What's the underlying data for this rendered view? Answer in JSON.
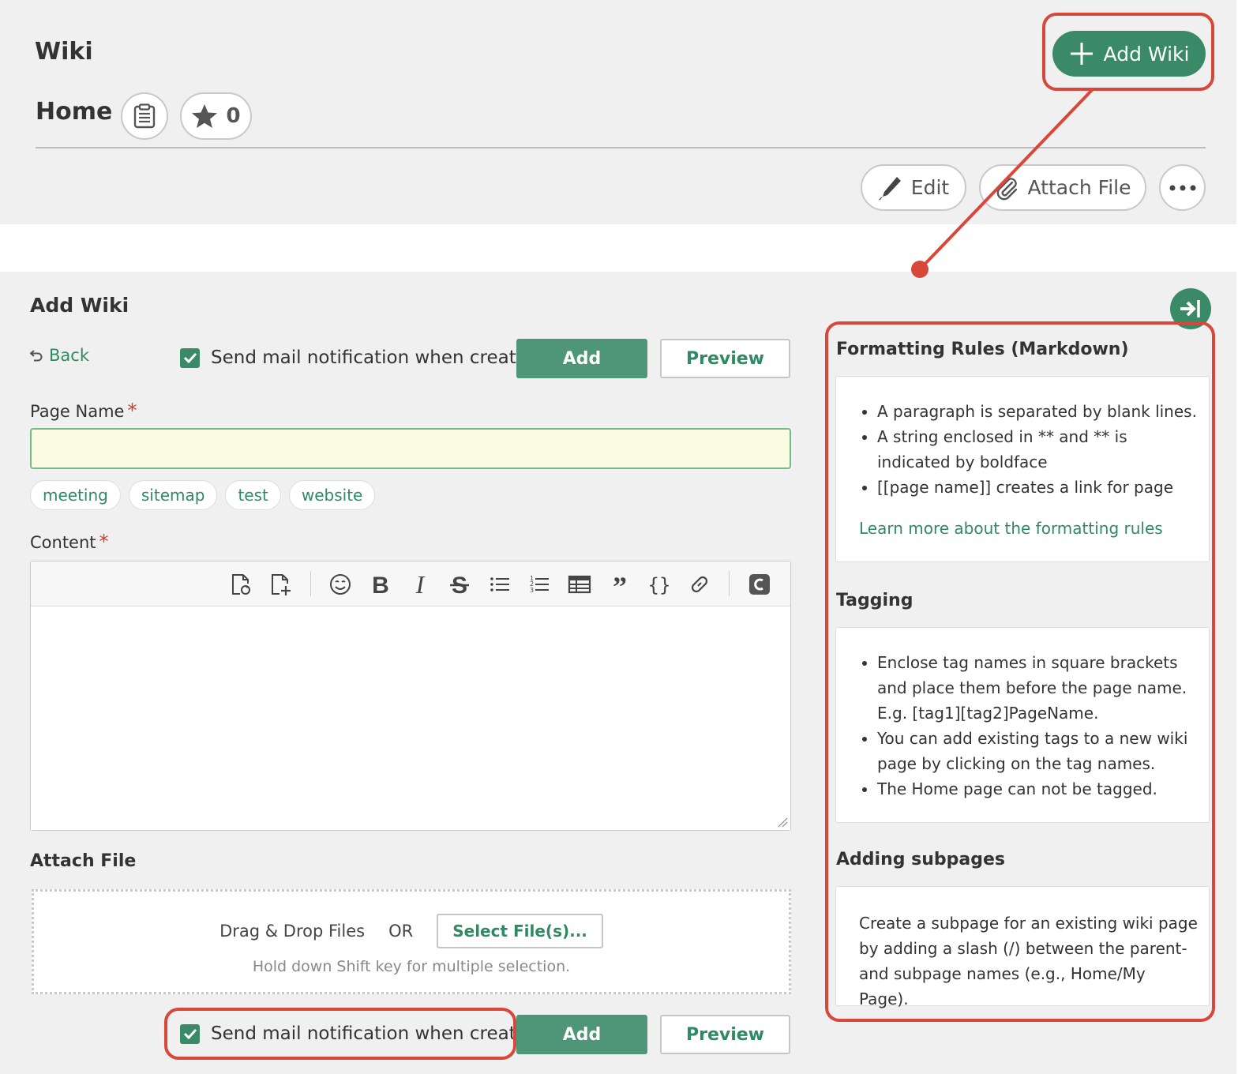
{
  "header": {
    "wiki_title": "Wiki",
    "home_title": "Home",
    "star_count": "0",
    "add_wiki_label": "Add Wiki",
    "edit_label": "Edit",
    "attach_file_label": "Attach File",
    "more_icon": "ellipsis-icon"
  },
  "form": {
    "heading": "Add Wiki",
    "back_label": "Back",
    "notify_label": "Send mail notification when created",
    "notify_checked": true,
    "add_label": "Add",
    "preview_label": "Preview",
    "page_name_label": "Page Name",
    "required_mark": "*",
    "page_name_value": "",
    "tags": [
      "meeting",
      "sitemap",
      "test",
      "website"
    ],
    "content_label": "Content",
    "content_value": "",
    "toolbar_icons": [
      "wiki-link-icon",
      "add-page-icon",
      "emoji-icon",
      "bold-icon",
      "italic-icon",
      "strikethrough-icon",
      "bullet-list-icon",
      "numbered-list-icon",
      "table-icon",
      "quote-icon",
      "code-icon",
      "link-icon",
      "color-icon"
    ],
    "attach_heading": "Attach File",
    "drag_drop_label": "Drag & Drop Files",
    "or_label": "OR",
    "select_files_label": "Select File(s)...",
    "drop_hint": "Hold down Shift key for multiple selection."
  },
  "help": {
    "formatting_heading": "Formatting Rules (Markdown)",
    "formatting_items": [
      "A paragraph is separated by blank lines.",
      "A string enclosed in ** and ** is indicated by boldface",
      "[[page name]] creates a link for page"
    ],
    "formatting_link": "Learn more about the formatting rules",
    "tagging_heading": "Tagging",
    "tagging_items": [
      "Enclose tag names in square brackets and place them before the page name. E.g. [tag1][tag2]PageName.",
      "You can add existing tags to a new wiki page by clicking on the tag names.",
      "The Home page can not be tagged."
    ],
    "subpages_heading": "Adding subpages",
    "subpages_text": "Create a subpage for an existing wiki page by adding a slash (/) between the parent- and subpage names (e.g., Home/My Page)."
  },
  "colors": {
    "accent_green": "#3a8a68",
    "link_green": "#2f8a63",
    "annotation_red": "#d9473a",
    "required_red": "#d0402f",
    "panel_bg": "#f0f0f0"
  }
}
